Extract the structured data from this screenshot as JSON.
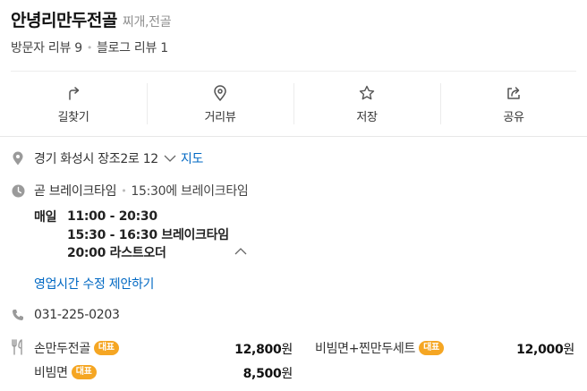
{
  "place": {
    "name": "안녕리만두전골",
    "category": "찌개,전골"
  },
  "reviews": {
    "visitor": "방문자 리뷰 9",
    "blog": "블로그 리뷰 1"
  },
  "actions": [
    {
      "label": "길찾기",
      "icon": "directions-icon"
    },
    {
      "label": "거리뷰",
      "icon": "location-pin-icon"
    },
    {
      "label": "저장",
      "icon": "star-icon"
    },
    {
      "label": "공유",
      "icon": "share-icon"
    }
  ],
  "address": {
    "text": "경기 화성시 장조2로 12",
    "map_link": "지도"
  },
  "hours": {
    "status": "곧 브레이크타임",
    "status_detail": "15:30에 브레이크타임",
    "day": "매일",
    "open": "11:00 - 20:30",
    "break_time": "15:30 - 16:30 브레이크타임",
    "last_order": "20:00 라스트오더",
    "suggest_edit": "영업시간 수정 제안하기"
  },
  "phone": "031-225-0203",
  "menu": {
    "badge": "대표",
    "items": [
      {
        "name": "손만두전골",
        "price": "12,800",
        "unit": "원"
      },
      {
        "name": "비빔면+찐만두세트",
        "price": "12,000",
        "unit": "원"
      },
      {
        "name": "비빔면",
        "price": "8,500",
        "unit": "원"
      }
    ]
  },
  "colors": {
    "link": "#0068c3",
    "badge": "#f5a623",
    "icon": "#9a9a9a"
  }
}
